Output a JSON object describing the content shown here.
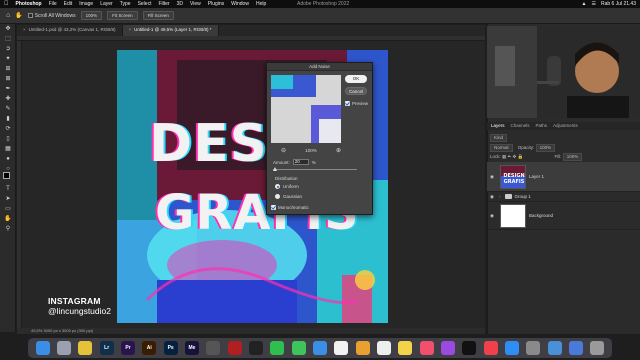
{
  "menubar": {
    "app": "Photoshop",
    "items": [
      "File",
      "Edit",
      "Image",
      "Layer",
      "Type",
      "Select",
      "Filter",
      "3D",
      "View",
      "Plugins",
      "Window",
      "Help"
    ],
    "window_title": "Adobe Photoshop 2022",
    "clock": "Rab 6 Jul 21.43"
  },
  "options_bar": {
    "scroll_all_windows": "Scroll All Windows",
    "zoom": "100%",
    "fit_screen": "Fit Screen",
    "fill_screen": "Fill Screen"
  },
  "doc_tabs": [
    {
      "label": "Untitled-1.psd @ 43,2% (Canvas 1, RGB/8)",
      "active": false
    },
    {
      "label": "Untitled-1 @ 49,5% (Layer 1, RGB/8) *",
      "active": true
    }
  ],
  "artwork": {
    "word1": "DESI",
    "word2": "GRAFIS"
  },
  "overlay": {
    "line1": "INSTAGRAM",
    "line2": "@lincungstudio2"
  },
  "status": "49,5%  3000 px x 3000 px (300 ppi)",
  "dialog": {
    "title": "Add Noise",
    "ok": "OK",
    "cancel": "Cancel",
    "preview": "Preview",
    "preview_checked": true,
    "zoom": "100%",
    "amount_label": "Amount:",
    "amount_value": "20",
    "amount_unit": "%",
    "distribution_label": "Distribution",
    "uniform": "Uniform",
    "gaussian": "Gaussian",
    "selected_distribution": "Uniform",
    "monochromatic": "Monochromatic",
    "monochromatic_checked": true
  },
  "layers_panel": {
    "tabs": [
      "Layers",
      "Channels",
      "Paths",
      "Adjustments"
    ],
    "kind": "Kind",
    "blend_mode": "Normal",
    "opacity_label": "Opacity:",
    "opacity": "100%",
    "lock_label": "Lock:",
    "fill_label": "Fill:",
    "fill": "100%",
    "layers": [
      {
        "name": "Layer 1",
        "type": "pixel",
        "selected": true
      },
      {
        "name": "Group 1",
        "type": "group",
        "selected": false
      },
      {
        "name": "Background",
        "type": "pixel",
        "selected": false
      }
    ],
    "thumb_text_1": "DESIGN",
    "thumb_text_2": "GRAFIS"
  },
  "tool_icons": [
    "move-icon",
    "marquee-icon",
    "lasso-icon",
    "quick-select-icon",
    "crop-icon",
    "frame-icon",
    "eyedropper-icon",
    "healing-icon",
    "brush-icon",
    "stamp-icon",
    "history-brush-icon",
    "eraser-icon",
    "gradient-icon",
    "blur-icon",
    "dodge-icon",
    "pen-icon",
    "type-icon",
    "path-select-icon",
    "shape-icon",
    "hand-icon",
    "zoom-icon"
  ],
  "dock_apps": [
    {
      "icon": "finder-icon",
      "label": "",
      "color": "#3a8ee6"
    },
    {
      "icon": "launchpad-icon",
      "label": "",
      "color": "#9aa0b0"
    },
    {
      "icon": "chrome-icon",
      "label": "",
      "color": "#e6c23a"
    },
    {
      "icon": "lightroom-icon",
      "label": "Lr",
      "color": "#0f2f4a"
    },
    {
      "icon": "premiere-icon",
      "label": "Pr",
      "color": "#2a1450"
    },
    {
      "icon": "illustrator-icon",
      "label": "Ai",
      "color": "#3a1c00"
    },
    {
      "icon": "photoshop-icon",
      "label": "Ps",
      "color": "#06213f"
    },
    {
      "icon": "media-encoder-icon",
      "label": "Me",
      "color": "#16123a"
    },
    {
      "icon": "camera-icon",
      "label": "",
      "color": "#555555"
    },
    {
      "icon": "filezilla-icon",
      "label": "",
      "color": "#b02020"
    },
    {
      "icon": "terminal-icon",
      "label": "",
      "color": "#222222"
    },
    {
      "icon": "messages-icon",
      "label": "",
      "color": "#2fbf4f"
    },
    {
      "icon": "facetime-icon",
      "label": "",
      "color": "#3ec45a"
    },
    {
      "icon": "mail-icon",
      "label": "",
      "color": "#3a8ee6"
    },
    {
      "icon": "calendar-icon",
      "label": "",
      "color": "#f2f2f2"
    },
    {
      "icon": "photos-icon",
      "label": "",
      "color": "#e8a030"
    },
    {
      "icon": "reminders-icon",
      "label": "",
      "color": "#eeeeee"
    },
    {
      "icon": "notes-icon",
      "label": "",
      "color": "#f3d34a"
    },
    {
      "icon": "music-icon",
      "label": "",
      "color": "#f0506e"
    },
    {
      "icon": "podcasts-icon",
      "label": "",
      "color": "#9b4ae0"
    },
    {
      "icon": "appletv-icon",
      "label": "",
      "color": "#111111"
    },
    {
      "icon": "news-icon",
      "label": "",
      "color": "#f0404a"
    },
    {
      "icon": "appstore-icon",
      "label": "",
      "color": "#2f8ef5"
    },
    {
      "icon": "settings-icon",
      "label": "",
      "color": "#8a8a8a"
    },
    {
      "icon": "preview-icon",
      "label": "",
      "color": "#4a90d9"
    },
    {
      "icon": "downloads-icon",
      "label": "",
      "color": "#4a7ad9"
    },
    {
      "icon": "trash-icon",
      "label": "",
      "color": "#9a9a9a"
    }
  ],
  "colors": {
    "accent": "#1a67d9",
    "panel_bg": "#2b2b2b",
    "dialog_bg": "#444444"
  }
}
